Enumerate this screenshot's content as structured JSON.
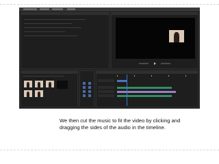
{
  "slide": {
    "caption": "We then cut the music to fit the video by clicking and dragging the sides of the audio in the timeline."
  },
  "colors": {
    "app_background": "#232323",
    "program_monitor": "#050505",
    "audio_clip": "#2f8f62",
    "music_clip": "#9d7fc6",
    "playhead": "#3a7ad9"
  }
}
